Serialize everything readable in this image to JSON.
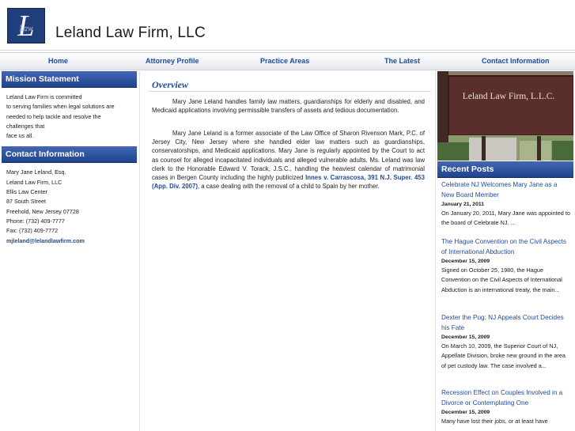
{
  "header": {
    "title": "Leland Law Firm, LLC",
    "logo_text": "Law",
    "logo_icon": "scales-logo"
  },
  "nav": {
    "items": [
      "Home",
      "Attorney Profile",
      "Practice Areas",
      "The Latest",
      "Contact Information"
    ]
  },
  "sidebar": {
    "mission": {
      "heading": "Mission Statement",
      "lines": [
        "Leland Law Firm is committed",
        "to serving families when legal solutions are",
        "needed to help tackle and resolve the",
        "challenges that",
        "face us all."
      ]
    },
    "contact": {
      "heading": "Contact Information",
      "lines": [
        "Mary Jane Leland, Esq.",
        "Leland Law Firm, LLC",
        "Ellis Law Center",
        "87 South Street",
        "Freehold, New Jersey 07728",
        "Phone: (732) 409-7777",
        "Fax: (732) 409-7772"
      ],
      "email": "mjleland@lelandlawfirm.com"
    }
  },
  "main": {
    "title": "Overview",
    "p1": "Mary Jane Leland handles family law matters, guardianships for elderly and disabled, and Medicaid applications involving permissible transfers of assets and tedious documentation.",
    "p2_a": "Mary Jane Leland is a former associate of the Law Office of Sharon Rivenson Mark, P.C. of Jersey City, New Jersey where she handled elder law matters such as guardianships, conservatorships, and Medicaid applications. Mary Jane is regularly appointed by the Court to act as counsel for alleged incapacitated individuals and alleged vulnerable adults. Ms. Leland was law clerk to the Honorable Edward V. Torack, J.S.C., handling the heaviest calendar of matrimonial cases in Bergen County including the highly publicized ",
    "p2_link": "Innes v. Carrascosa, 391 N.J. Super. 453 (App. Div. 2007)",
    "p2_b": ", a case dealing with the removal of a child to Spain by her mother."
  },
  "right": {
    "photo_sign": "Leland Law Firm, L.L.C.",
    "recent_heading": "Recent Posts",
    "posts": [
      {
        "title": "Celebrate NJ Welcomes Mary Jane as a New Board Member",
        "date": "January 21, 2011",
        "excerpt": "On January 20, 2011, Mary Jane was appointed to the board of Celebrate NJ. ..."
      },
      {
        "title": "The Hague Convention on the Civil Aspects of International Abduction",
        "date": "December 15, 2009",
        "excerpt": "Signed on October 25, 1980, the Hague Convention on the Civil Aspects of International Abduction is an international treaty, the main..."
      },
      {
        "title": "Dexter the Pug: NJ Appeals Court Decides his Fate",
        "date": "December 15, 2009",
        "excerpt": "On March 10, 2009, the Superior Court of NJ, Appellate Division, broke new ground in the area of pet custody law. The case involved a..."
      },
      {
        "title": "Recession Effect on Couples Involved in a Divorce or Contemplating One",
        "date": "December 15, 2009",
        "excerpt": "Many have lost their jobs, or at least have"
      }
    ]
  },
  "colors": {
    "accent": "#1f4a9a",
    "header_bar": "#20438d"
  }
}
